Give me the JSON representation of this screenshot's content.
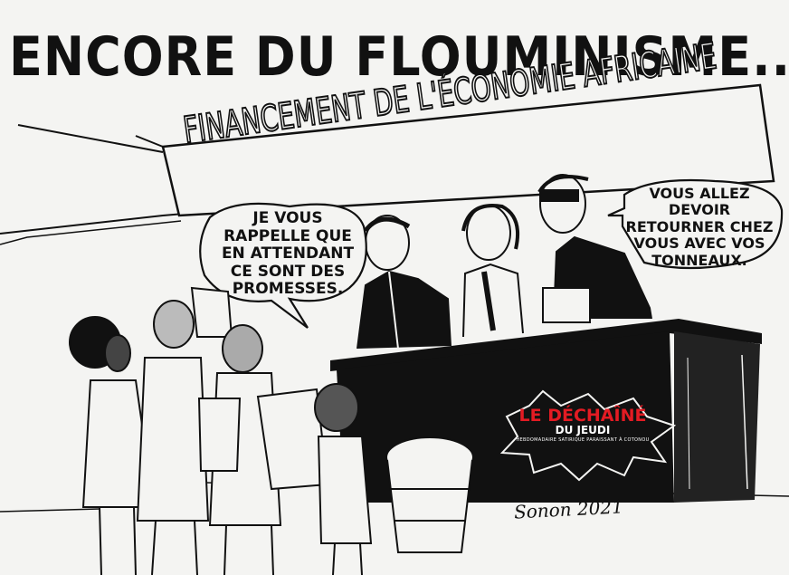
{
  "title": "ENCORE DU FLOUMINISME...",
  "banner": "FINANCEMENT DE L'ÉCONOMIE AFRICAINE",
  "bubble_left": "JE VOUS RAPPELLE QUE EN ATTENDANT CE SONT DES PROMESSES.",
  "bubble_right": "VOUS ALLEZ DEVOIR RETOURNER CHEZ VOUS AVEC VOS TONNEAUX.",
  "logo": {
    "main": "LE DÉCHAÎNÉ",
    "sub": "DU JEUDI",
    "tagline": "HEBDOMADAIRE SATIRIQUE PARAISSANT À COTONOU"
  },
  "signature": "Sonon 2021",
  "colors": {
    "ink": "#111111",
    "paper": "#f4f4f2",
    "logo_red": "#e31b23"
  }
}
